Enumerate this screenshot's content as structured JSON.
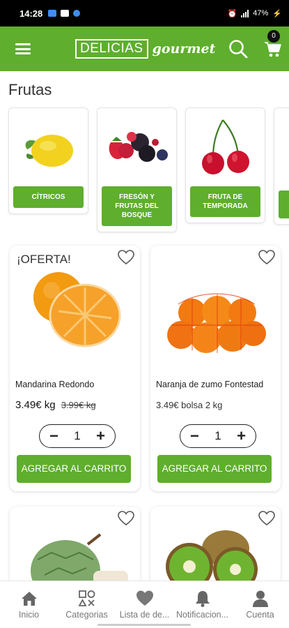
{
  "status_bar": {
    "time": "14:28",
    "battery": "47%"
  },
  "header": {
    "logo_box": "DELICIAS",
    "logo_script": "gourmet",
    "cart_count": "0",
    "brand_color": "#5fae2e"
  },
  "section": {
    "title": "Frutas"
  },
  "categories": [
    {
      "label": "CÍTRICOS",
      "icon": "lemon-icon"
    },
    {
      "label": "FRESÓN Y FRUTAS DEL BOSQUE",
      "icon": "berries-icon"
    },
    {
      "label": "FRUTA DE TEMPORADA",
      "icon": "cherries-icon"
    }
  ],
  "products": [
    {
      "badge": "¡OFERTA!",
      "name": "Mandarina Redondo",
      "price": "3.49€ kg",
      "old_price": "3.99€ kg",
      "quantity": "1",
      "add_label": "AGREGAR AL CARRITO"
    },
    {
      "badge": "",
      "name": "Naranja de zumo Fontestad",
      "price": "3.49€ bolsa 2 kg",
      "old_price": "",
      "quantity": "1",
      "add_label": "AGREGAR AL CARRITO"
    }
  ],
  "bottom_nav": [
    {
      "label": "Inicio",
      "icon": "home-icon"
    },
    {
      "label": "Categorias",
      "icon": "categories-icon"
    },
    {
      "label": "Lista de de...",
      "icon": "heart-icon"
    },
    {
      "label": "Notificacion...",
      "icon": "bell-icon"
    },
    {
      "label": "Cuenta",
      "icon": "user-icon"
    }
  ]
}
